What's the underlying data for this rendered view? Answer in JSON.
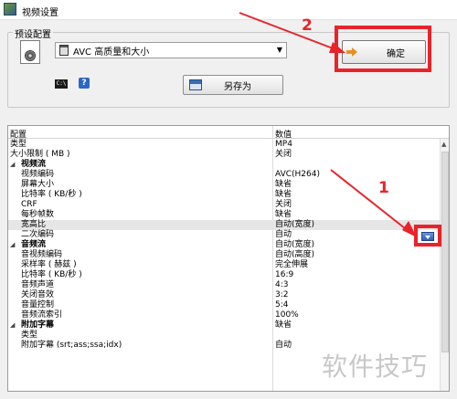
{
  "window": {
    "title": "视频设置"
  },
  "preset": {
    "legend": "预设配置",
    "selected": "AVC 高质量和大小",
    "save_as_label": "另存为"
  },
  "ok_label": "确定",
  "annotations": {
    "one": "1",
    "two": "2"
  },
  "grid": {
    "header_key": "配置",
    "header_val": "数值",
    "rows": [
      {
        "key": "类型",
        "val": "MP4"
      },
      {
        "key": "大小限制 ( MB )",
        "val": "关闭"
      },
      {
        "key": "视频流",
        "val": ""
      },
      {
        "key": "视频编码",
        "val": "AVC(H264)"
      },
      {
        "key": "屏幕大小",
        "val": "缺省"
      },
      {
        "key": "比特率 ( KB/秒 )",
        "val": "缺省"
      },
      {
        "key": "CRF",
        "val": "关闭"
      },
      {
        "key": "每秒帧数",
        "val": "缺省"
      },
      {
        "key": "宽高比",
        "val": "自动(宽度)"
      },
      {
        "key": "二次编码",
        "val": "自动"
      },
      {
        "key": "音频流",
        "val": "自动(宽度)"
      },
      {
        "key": "音视频编码",
        "val": "自动(高度)"
      },
      {
        "key": "采样率 ( 赫兹 )",
        "val": "完全伸展"
      },
      {
        "key": "比特率 ( KB/秒 )",
        "val": "16:9"
      },
      {
        "key": "音频声道",
        "val": "4:3"
      },
      {
        "key": "关闭音效",
        "val": "3:2"
      },
      {
        "key": "音量控制",
        "val": "5:4"
      },
      {
        "key": "音频流索引",
        "val": "100%"
      },
      {
        "key": "附加字幕",
        "val": "缺省"
      },
      {
        "key": "类型",
        "val": ""
      },
      {
        "key": "附加字幕 (srt;ass;ssa;idx)",
        "val": "自动"
      },
      {
        "key": "",
        "val": ""
      }
    ]
  },
  "dropdown_options": [
    "自动",
    "自动(宽度)",
    "自动(高度)",
    "完全伸展",
    "16:9",
    "4:3",
    "3:2",
    "5:4"
  ],
  "watermark": "软件技巧",
  "colors": {
    "annotation_red": "#e8232a"
  }
}
